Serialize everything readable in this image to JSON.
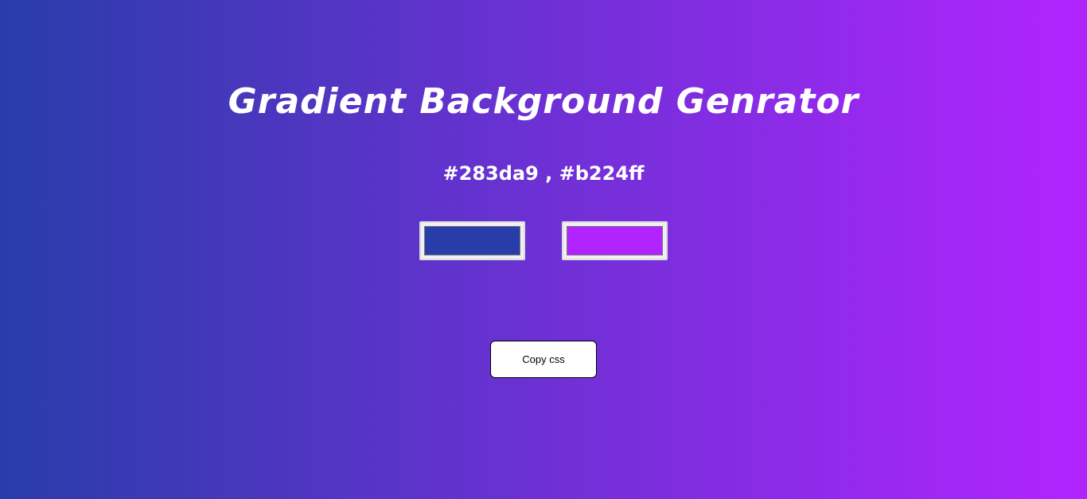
{
  "title": "Gradient Background Genrator",
  "color_readout": "#283da9 , #b224ff",
  "colors": {
    "start": "#283da9",
    "end": "#b224ff"
  },
  "pickers": [
    {
      "value": "#283da9"
    },
    {
      "value": "#b224ff"
    }
  ],
  "copy_button": {
    "label": "Copy css"
  }
}
